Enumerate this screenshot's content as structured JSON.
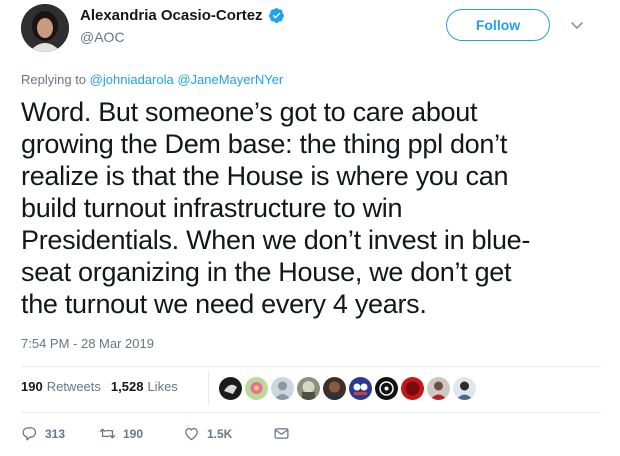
{
  "author": {
    "name": "Alexandria Ocasio-Cortez",
    "handle": "@AOC",
    "verified_icon": "verified-badge-icon"
  },
  "follow_label": "Follow",
  "replying": {
    "prefix": "Replying to",
    "mentions": [
      "@johniadarola",
      "@JaneMayerNYer"
    ]
  },
  "tweet_lines": [
    "Word. But someone’s got to care about",
    "growing the Dem base: the thing ppl don’t",
    "realize is that the House is where you can",
    "build turnout infrastructure to win",
    "Presidentials. When we don’t invest in blue-",
    "seat organizing in the House, we don’t get",
    "the turnout we need every 4 years."
  ],
  "timestamp": "7:54 PM - 28 Mar 2019",
  "stats": {
    "retweets_count": "190",
    "retweets_label": "Retweets",
    "likes_count": "1,528",
    "likes_label": "Likes"
  },
  "actions": {
    "reply_count": "313",
    "retweet_count": "190",
    "like_count": "1.5K"
  },
  "colors": {
    "accent": "#1da1f2",
    "text": "#14171a",
    "muted": "#657786",
    "divider": "#e6ecf0"
  }
}
